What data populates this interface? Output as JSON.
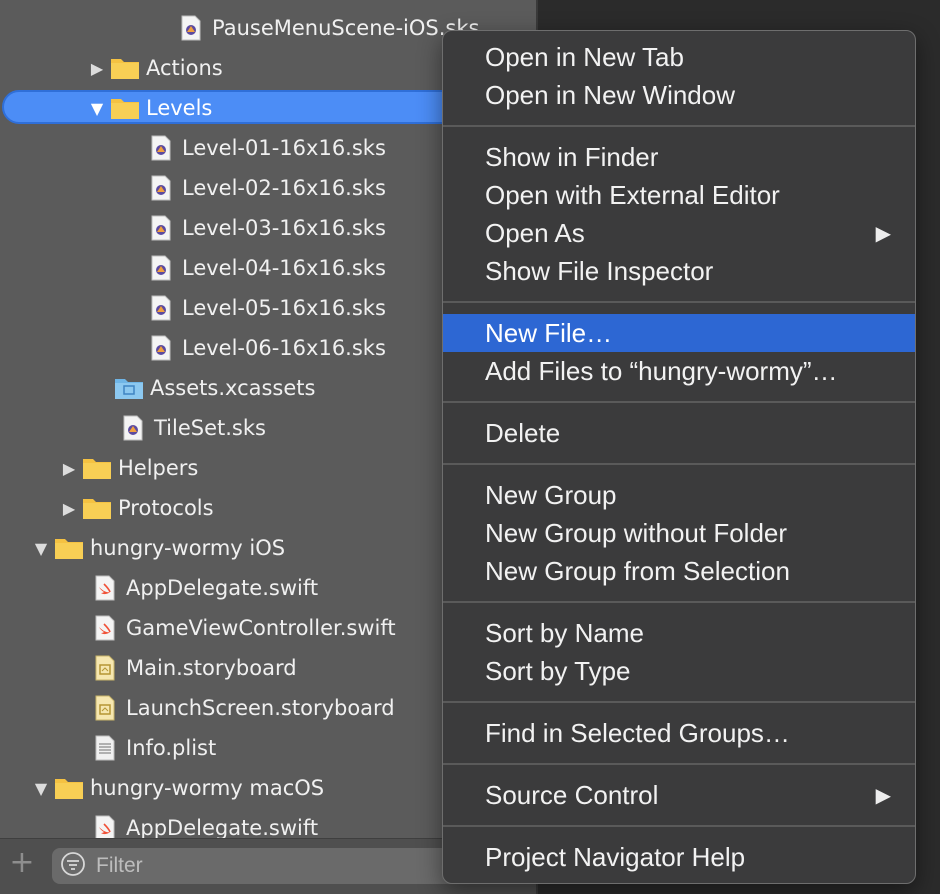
{
  "navigator": {
    "rows": [
      {
        "label": "PauseMenuScene-iOS.sks"
      },
      {
        "label": "Actions"
      },
      {
        "label": "Levels"
      },
      {
        "label": "Level-01-16x16.sks"
      },
      {
        "label": "Level-02-16x16.sks"
      },
      {
        "label": "Level-03-16x16.sks"
      },
      {
        "label": "Level-04-16x16.sks"
      },
      {
        "label": "Level-05-16x16.sks"
      },
      {
        "label": "Level-06-16x16.sks"
      },
      {
        "label": "Assets.xcassets"
      },
      {
        "label": "TileSet.sks"
      },
      {
        "label": "Helpers"
      },
      {
        "label": "Protocols"
      },
      {
        "label": "hungry-wormy iOS"
      },
      {
        "label": "AppDelegate.swift"
      },
      {
        "label": "GameViewController.swift"
      },
      {
        "label": "Main.storyboard"
      },
      {
        "label": "LaunchScreen.storyboard"
      },
      {
        "label": "Info.plist"
      },
      {
        "label": "hungry-wormy macOS"
      },
      {
        "label": "AppDelegate.swift"
      }
    ],
    "filter_placeholder": "Filter"
  },
  "context_menu": {
    "items": {
      "open_new_tab": "Open in New Tab",
      "open_new_window": "Open in New Window",
      "show_in_finder": "Show in Finder",
      "open_external": "Open with External Editor",
      "open_as": "Open As",
      "show_file_inspector": "Show File Inspector",
      "new_file": "New File…",
      "add_files": "Add Files to “hungry-wormy”…",
      "delete": "Delete",
      "new_group": "New Group",
      "new_group_no_folder": "New Group without Folder",
      "new_group_from_selection": "New Group from Selection",
      "sort_by_name": "Sort by Name",
      "sort_by_type": "Sort by Type",
      "find_in_groups": "Find in Selected Groups…",
      "source_control": "Source Control",
      "navigator_help": "Project Navigator Help"
    },
    "highlighted": "New File…"
  },
  "colors": {
    "selection": "#4c8df6",
    "menu_highlight": "#2d67d3",
    "folder": "#f5c242",
    "swift": "#f05138"
  }
}
